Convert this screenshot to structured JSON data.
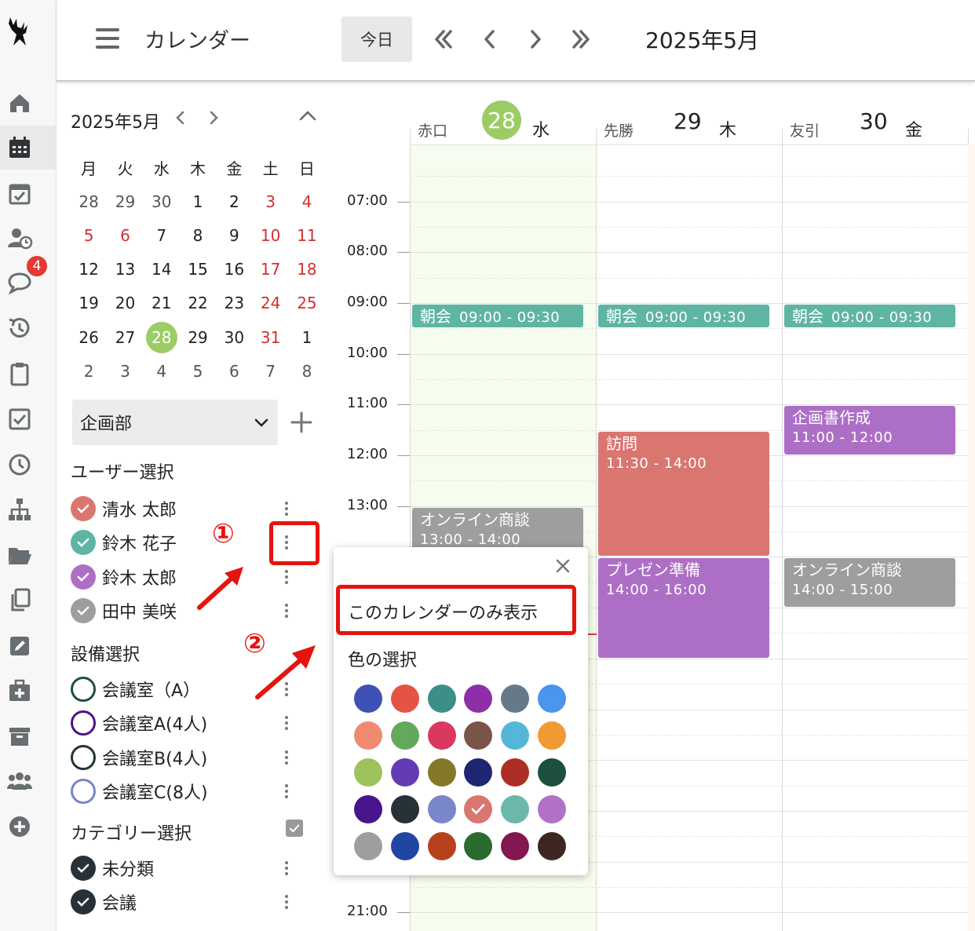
{
  "header": {
    "title": "カレンダー",
    "today_label": "今日",
    "month_label": "2025年5月"
  },
  "rail": {
    "logo": "deer-logo",
    "items": [
      "home-icon",
      "calendar-icon",
      "calendar-check-icon",
      "user-clock-icon",
      "chat-icon",
      "history-icon",
      "clipboard-icon",
      "checkbox-icon",
      "clock-icon",
      "org-chart-icon",
      "folder-icon",
      "copy-icon",
      "edit-icon",
      "first-aid-icon",
      "archive-icon",
      "users-icon",
      "add-circle-icon"
    ],
    "chat_badge": "4"
  },
  "mini_calendar": {
    "month_label": "2025年5月",
    "weekdays": [
      "月",
      "火",
      "水",
      "木",
      "金",
      "土",
      "日"
    ],
    "weeks": [
      [
        "28",
        "29",
        "30",
        "1",
        "2",
        "3",
        "4"
      ],
      [
        "5",
        "6",
        "7",
        "8",
        "9",
        "10",
        "11"
      ],
      [
        "12",
        "13",
        "14",
        "15",
        "16",
        "17",
        "18"
      ],
      [
        "19",
        "20",
        "21",
        "22",
        "23",
        "24",
        "25"
      ],
      [
        "26",
        "27",
        "28",
        "29",
        "30",
        "31",
        "1"
      ],
      [
        "2",
        "3",
        "4",
        "5",
        "6",
        "7",
        "8"
      ]
    ],
    "holidays": [
      [
        0,
        5
      ],
      [
        0,
        6
      ],
      [
        1,
        0
      ],
      [
        1,
        1
      ],
      [
        1,
        5
      ],
      [
        1,
        6
      ],
      [
        2,
        5
      ],
      [
        2,
        6
      ],
      [
        3,
        5
      ],
      [
        3,
        6
      ],
      [
        4,
        5
      ]
    ],
    "today_cell": [
      4,
      2
    ]
  },
  "sidebar": {
    "group_select": "企画部",
    "user_section": "ユーザー選択",
    "users": [
      {
        "name": "清水 太郎",
        "color": "#d97670",
        "checked": true
      },
      {
        "name": "鈴木 花子",
        "color": "#5fb5a4",
        "checked": true
      },
      {
        "name": "鈴木 太郎",
        "color": "#ad6fc6",
        "checked": true
      },
      {
        "name": "田中 美咲",
        "color": "#9e9e9e",
        "checked": true
      }
    ],
    "facility_section": "設備選択",
    "facilities": [
      {
        "name": "会議室（A）",
        "color": "#1d4f3f"
      },
      {
        "name": "会議室A(4人)",
        "color": "#4a148c"
      },
      {
        "name": "会議室B(4人)",
        "color": "#263238"
      },
      {
        "name": "会議室C(8人)",
        "color": "#7986cb"
      }
    ],
    "category_section": "カテゴリー選択",
    "categories": [
      {
        "name": "未分類",
        "color": "#263238"
      },
      {
        "name": "会議",
        "color": "#263238"
      }
    ]
  },
  "calendar": {
    "days": [
      {
        "rokuyo": "赤口",
        "num": "28",
        "weekday": "水",
        "today": true
      },
      {
        "rokuyo": "先勝",
        "num": "29",
        "weekday": "木",
        "today": false
      },
      {
        "rokuyo": "友引",
        "num": "30",
        "weekday": "金",
        "today": false
      }
    ],
    "times": [
      "07:00",
      "08:00",
      "09:00",
      "10:00",
      "11:00",
      "12:00",
      "13:00",
      "21:00"
    ],
    "events": [
      {
        "title": "朝会",
        "range": "09:00 - 09:30",
        "inline": true,
        "color": "#5fb5a4"
      },
      {
        "title": "朝会",
        "range": "09:00 - 09:30",
        "inline": true,
        "color": "#5fb5a4"
      },
      {
        "title": "朝会",
        "range": "09:00 - 09:30",
        "inline": true,
        "color": "#5fb5a4"
      },
      {
        "title": "オンライン商談",
        "range": "13:00 - 14:00",
        "color": "#9e9e9e"
      },
      {
        "title": "訪問",
        "range": "11:30 - 14:00",
        "color": "#d97670"
      },
      {
        "title": "プレゼン準備",
        "range": "14:00 - 16:00",
        "color": "#ad6fc6"
      },
      {
        "title": "企画書作成",
        "range": "11:00 - 12:00",
        "color": "#ad6fc6"
      },
      {
        "title": "オンライン商談",
        "range": "14:00 - 15:00",
        "color": "#9e9e9e"
      }
    ]
  },
  "popup": {
    "only_label": "このカレンダーのみ表示",
    "color_title": "色の選択",
    "colors": [
      "#3f51b5",
      "#e55343",
      "#3d8e86",
      "#8e2fa8",
      "#647a8a",
      "#4a95ee",
      "#f08a6e",
      "#63a95b",
      "#d9385f",
      "#795548",
      "#53b7d8",
      "#f19a34",
      "#9ec25c",
      "#633bb5",
      "#837828",
      "#1f2673",
      "#ad2e25",
      "#1d4f3f",
      "#4a148c",
      "#263238",
      "#7986cb",
      "#d97670",
      "#6bb7ab",
      "#b071c7",
      "#9e9e9e",
      "#1f47a1",
      "#b8411d",
      "#2a6b2f",
      "#82184f",
      "#3e2723"
    ],
    "selected_index": 21
  },
  "annotations": {
    "step1": "①",
    "step2": "②"
  }
}
